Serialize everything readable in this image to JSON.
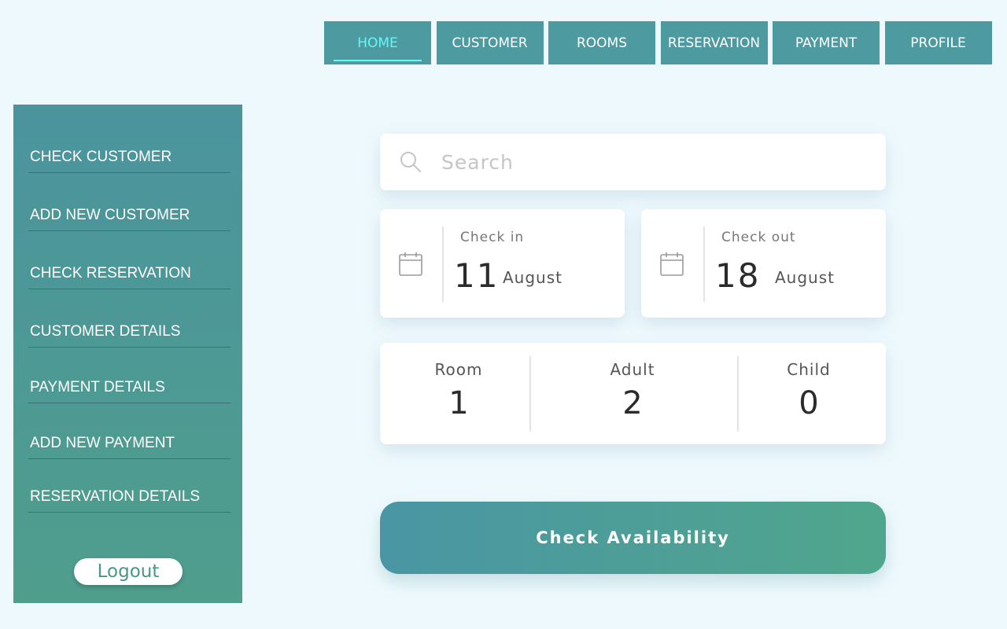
{
  "nav": {
    "items": [
      {
        "label": "HOME",
        "active": true
      },
      {
        "label": "CUSTOMER",
        "active": false
      },
      {
        "label": "ROOMS",
        "active": false
      },
      {
        "label": "RESERVATION",
        "active": false
      },
      {
        "label": "PAYMENT",
        "active": false
      },
      {
        "label": "PROFILE",
        "active": false
      }
    ]
  },
  "sidebar": {
    "items": [
      {
        "label": "CHECK CUSTOMER"
      },
      {
        "label": "ADD NEW CUSTOMER"
      },
      {
        "label": "CHECK RESERVATION"
      },
      {
        "label": "CUSTOMER DETAILS"
      },
      {
        "label": "PAYMENT DETAILS"
      },
      {
        "label": "ADD NEW PAYMENT"
      },
      {
        "label": "RESERVATION DETAILS"
      }
    ],
    "logout_label": "Logout"
  },
  "search": {
    "placeholder": "Search",
    "value": "",
    "icon": "search-icon"
  },
  "checkin": {
    "label": "Check in",
    "day": "11",
    "month": "August",
    "icon": "calendar-icon"
  },
  "checkout": {
    "label": "Check out",
    "day": "18",
    "month": "August",
    "icon": "calendar-icon"
  },
  "guests": {
    "room": {
      "label": "Room",
      "value": "1"
    },
    "adult": {
      "label": "Adult",
      "value": "2"
    },
    "child": {
      "label": "Child",
      "value": "0"
    }
  },
  "action": {
    "check_label": "Check Availability"
  },
  "colors": {
    "background": "#eef9fd",
    "nav_bg": "#4d9aa0",
    "nav_active_text": "#68f4f8",
    "sidebar_top": "#4b949e",
    "sidebar_bottom": "#4f9e8c",
    "button_start": "#4a96a4",
    "button_end": "#50a68c"
  }
}
